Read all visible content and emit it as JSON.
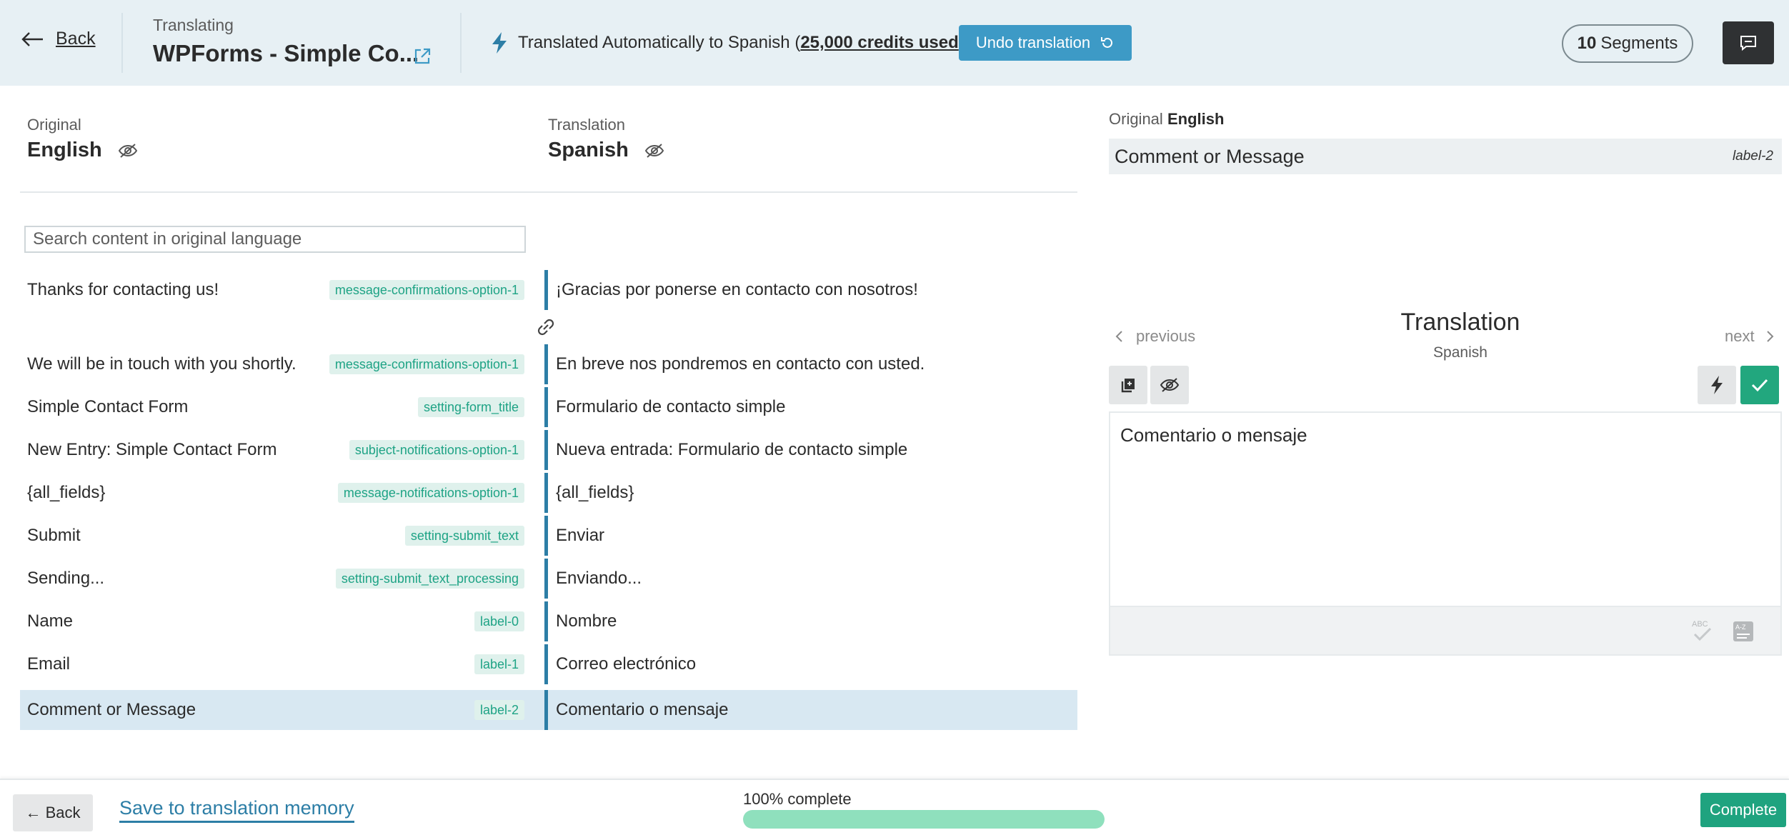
{
  "header": {
    "back_label": "Back",
    "translating_label": "Translating",
    "doc_title": "WPForms - Simple Co...",
    "auto_msg_prefix": "Translated Automatically to Spanish (",
    "auto_msg_credits": "25,000 credits used",
    "auto_msg_suffix": ")",
    "undo_label": "Undo translation",
    "segments_count": "10",
    "segments_label": "Segments"
  },
  "editor": {
    "original_label": "Original",
    "original_lang": "English",
    "translation_label": "Translation",
    "translation_lang": "Spanish",
    "search_placeholder": "Search content in original language",
    "search_value": "",
    "segments": [
      {
        "original": "Thanks for contacting us!",
        "key": "message-confirmations-option-1",
        "translation": "¡Gracias por ponerse en contacto con nosotros!"
      },
      {
        "original": "We will be in touch with you shortly.",
        "key": "message-confirmations-option-1",
        "translation": "En breve nos pondremos en contacto con usted."
      },
      {
        "original": "Simple Contact Form",
        "key": "setting-form_title",
        "translation": "Formulario de contacto simple"
      },
      {
        "original": "New Entry: Simple Contact Form",
        "key": "subject-notifications-option-1",
        "translation": "Nueva entrada: Formulario de contacto simple"
      },
      {
        "original": "{all_fields}",
        "key": "message-notifications-option-1",
        "translation": "{all_fields}"
      },
      {
        "original": "Submit",
        "key": "setting-submit_text",
        "translation": "Enviar"
      },
      {
        "original": "Sending...",
        "key": "setting-submit_text_processing",
        "translation": "Enviando..."
      },
      {
        "original": "Name",
        "key": "label-0",
        "translation": "Nombre"
      },
      {
        "original": "Email",
        "key": "label-1",
        "translation": "Correo electrónico"
      },
      {
        "original": "Comment or Message",
        "key": "label-2",
        "translation": "Comentario o mensaje"
      }
    ]
  },
  "panel": {
    "original_label": "Original",
    "original_lang": "English",
    "original_text": "Comment or Message",
    "original_key": "label-2",
    "prev_label": "previous",
    "next_label": "next",
    "translation_title": "Translation",
    "translation_lang": "Spanish",
    "translation_text": "Comentario o mensaje",
    "spell_badge": "ABC",
    "dict_badge": "A-Z"
  },
  "footer": {
    "back_label": "← Back",
    "save_tm_label": "Save to translation memory",
    "progress_label": "100% complete",
    "progress_fraction": 1.0,
    "complete_label": "Complete"
  },
  "colors": {
    "header_bg": "#e7f0f4",
    "accent_blue": "#3d9ac6",
    "tag_green": "#1ea385",
    "complete_green": "#1fa37f",
    "active_row": "#d8e8f2"
  }
}
